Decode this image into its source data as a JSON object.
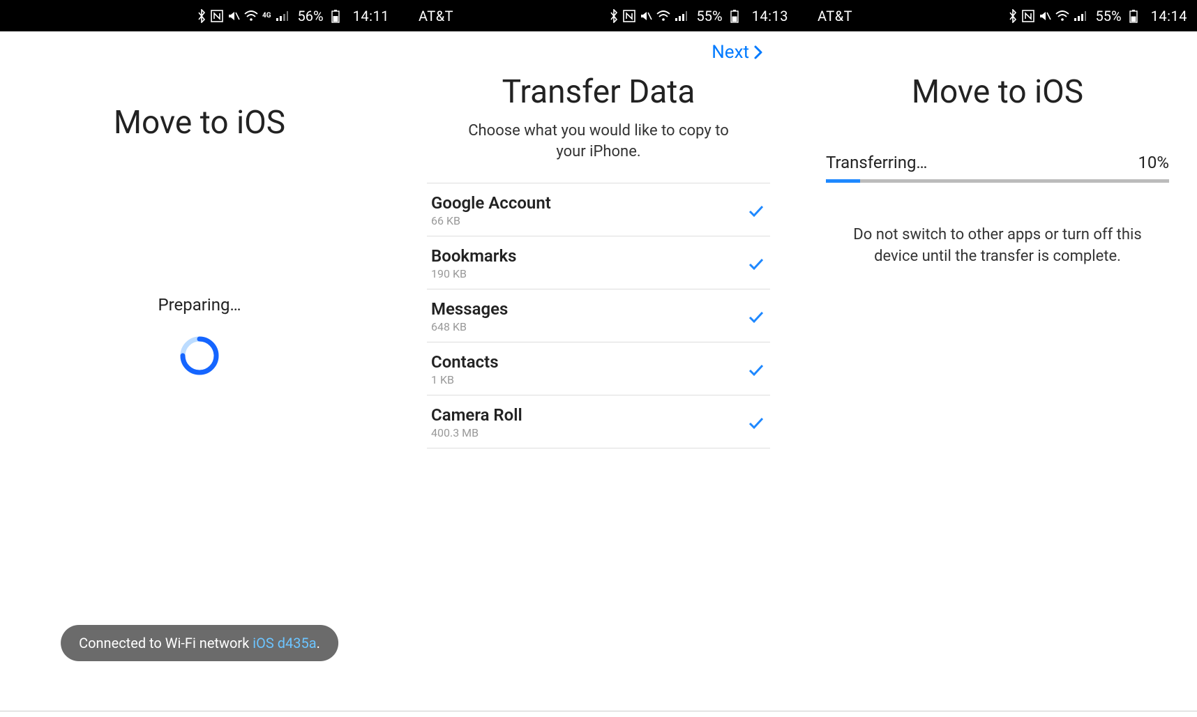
{
  "screens": [
    {
      "status": {
        "carrier": "",
        "battery_pct": "56%",
        "time": "14:11",
        "signal_4g": true
      },
      "title": "Move to iOS",
      "preparing_label": "Preparing…",
      "toast_prefix": "Connected to Wi-Fi network ",
      "toast_network": "iOS d435a",
      "toast_suffix": "."
    },
    {
      "status": {
        "carrier": "AT&T",
        "battery_pct": "55%",
        "time": "14:13",
        "signal_4g": false
      },
      "next_label": "Next",
      "title": "Transfer Data",
      "subtitle": "Choose what you would like to copy to your iPhone.",
      "items": [
        {
          "title": "Google Account",
          "size": "66 KB"
        },
        {
          "title": "Bookmarks",
          "size": "190 KB"
        },
        {
          "title": "Messages",
          "size": "648 KB"
        },
        {
          "title": "Contacts",
          "size": "1 KB"
        },
        {
          "title": "Camera Roll",
          "size": "400.3 MB"
        }
      ]
    },
    {
      "status": {
        "carrier": "AT&T",
        "battery_pct": "55%",
        "time": "14:14",
        "signal_4g": false
      },
      "title": "Move to iOS",
      "transfer_label": "Transferring…",
      "transfer_pct_text": "10%",
      "transfer_pct_value": 10,
      "warning": "Do not switch to other apps or turn off this device until the transfer is complete."
    }
  ]
}
